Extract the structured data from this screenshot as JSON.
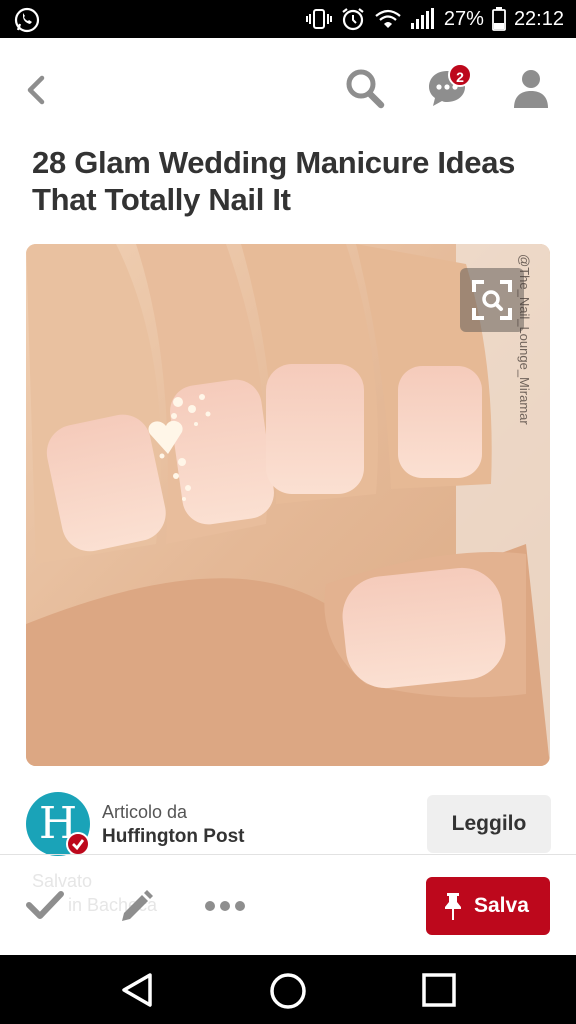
{
  "status_bar": {
    "battery_percent": "27%",
    "time": "22:12",
    "icons": [
      "whatsapp-icon",
      "vibrate-icon",
      "alarm-icon",
      "wifi-icon",
      "signal-icon",
      "battery-icon"
    ]
  },
  "header": {
    "icons": [
      "back-arrow-icon",
      "search-icon",
      "messages-icon",
      "profile-icon"
    ],
    "notification_count": "2"
  },
  "pin": {
    "title": "28 Glam Wedding Manicure Ideas That Totally Nail It",
    "image_watermark": "@The_Nail_Lounge_Miramar"
  },
  "source": {
    "label": "Articolo da",
    "name": "Huffington Post",
    "logo_letter": "H",
    "read_button": "Leggilo"
  },
  "actions": {
    "ghost_text_1": "Salvato",
    "ghost_text_2": "in Bacheca",
    "save_button": "Salva",
    "icons": [
      "check-icon",
      "edit-icon",
      "more-icon",
      "pin-icon"
    ]
  },
  "nav": {
    "icons": [
      "nav-back-icon",
      "nav-home-icon",
      "nav-recents-icon"
    ]
  },
  "colors": {
    "brand_red": "#bd081c",
    "huffpost_teal": "#1aa3b8",
    "icon_gray": "#8e8e8e"
  }
}
